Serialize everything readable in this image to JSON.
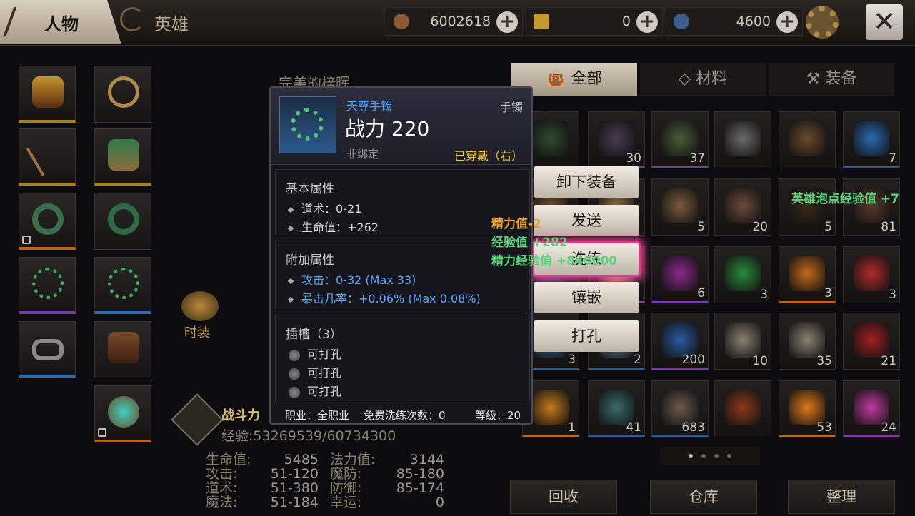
{
  "header": {
    "tab_character": "人物",
    "tab_hero": "英雄",
    "currency": [
      {
        "icon": "copper-coin-icon",
        "value": "6002618"
      },
      {
        "icon": "gold-ingot-icon",
        "value": "0"
      },
      {
        "icon": "blue-gem-icon",
        "value": "4600"
      }
    ],
    "plus_symbol": "+",
    "close_symbol": "✕"
  },
  "character": {
    "name": "完美的梓晖",
    "fashion_label": "时装",
    "power_label": "战斗力",
    "exp_text": "经验:53269539/60734300",
    "stats": [
      {
        "k1": "生命值:",
        "v1": "5485",
        "k2": "法力值:",
        "v2": "3144"
      },
      {
        "k1": "攻击:",
        "v1": "51-120",
        "k2": "魔防:",
        "v2": "85-180"
      },
      {
        "k1": "道术:",
        "v1": "51-380",
        "k2": "防御:",
        "v2": "85-174"
      },
      {
        "k1": "魔法:",
        "v1": "51-184",
        "k2": "幸运:",
        "v2": "0"
      }
    ]
  },
  "inventory": {
    "tabs": [
      "全部",
      "材料",
      "装备"
    ],
    "counts": [
      "",
      "30",
      "37",
      "",
      "",
      "7",
      "",
      "",
      "5",
      "20",
      "5",
      "81",
      "",
      "",
      "6",
      "3",
      "3",
      "3",
      "3",
      "2",
      "200",
      "10",
      "35",
      "21",
      "1",
      "41",
      "683",
      "",
      "53",
      "24"
    ],
    "footer_buttons": [
      "回收",
      "仓库",
      "整理"
    ]
  },
  "actions": {
    "unequip": "卸下装备",
    "send": "发送",
    "refine": "洗练",
    "inlay": "镶嵌",
    "punch": "打孔"
  },
  "tooltip": {
    "item_name": "天尊手镯",
    "item_type": "手镯",
    "power": "战力 220",
    "bind": "非绑定",
    "worn": "已穿戴（右）",
    "basic_title": "基本属性",
    "basic": [
      "道术：0-21",
      "生命值：+262"
    ],
    "extra_title": "附加属性",
    "extra": [
      "攻击：0-32 (Max 33)",
      "暴击几率：+0.06% (Max 0.08%)"
    ],
    "socket_title": "插槽（3）",
    "sockets": [
      "可打孔",
      "可打孔",
      "可打孔"
    ],
    "job": "职业：全职业",
    "free_refine": "免费洗练次数：0",
    "level": "等级：20"
  },
  "floating": {
    "energy": "精力值-2",
    "exp": "经验值 +282",
    "energy_exp": "精力经验值 +846000",
    "hero_exp": "英雄泡点经验值 +7"
  }
}
